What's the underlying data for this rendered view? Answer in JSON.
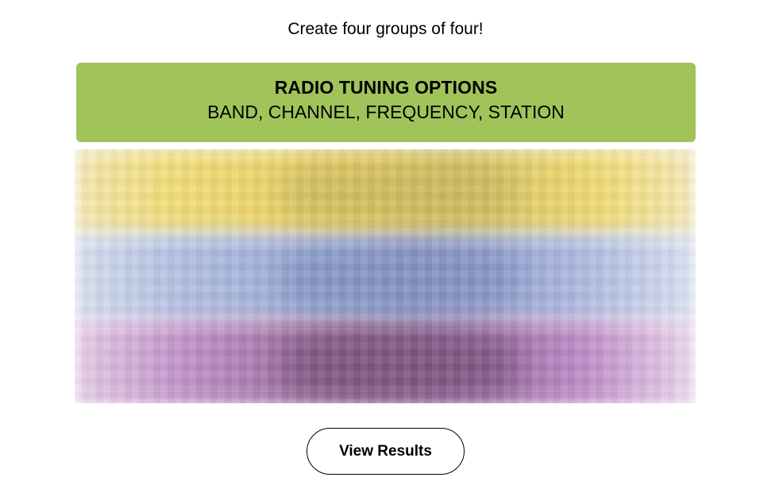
{
  "game": {
    "instructions": "Create four groups of four!",
    "solved_groups": [
      {
        "title": "RADIO TUNING OPTIONS",
        "members": "BAND, CHANNEL, FREQUENCY, STATION",
        "color": "#a0c35a"
      }
    ],
    "hidden_group_colors": [
      "#f1dc78",
      "#afbde0",
      "#c08fc8"
    ],
    "results_button_label": "View Results"
  }
}
